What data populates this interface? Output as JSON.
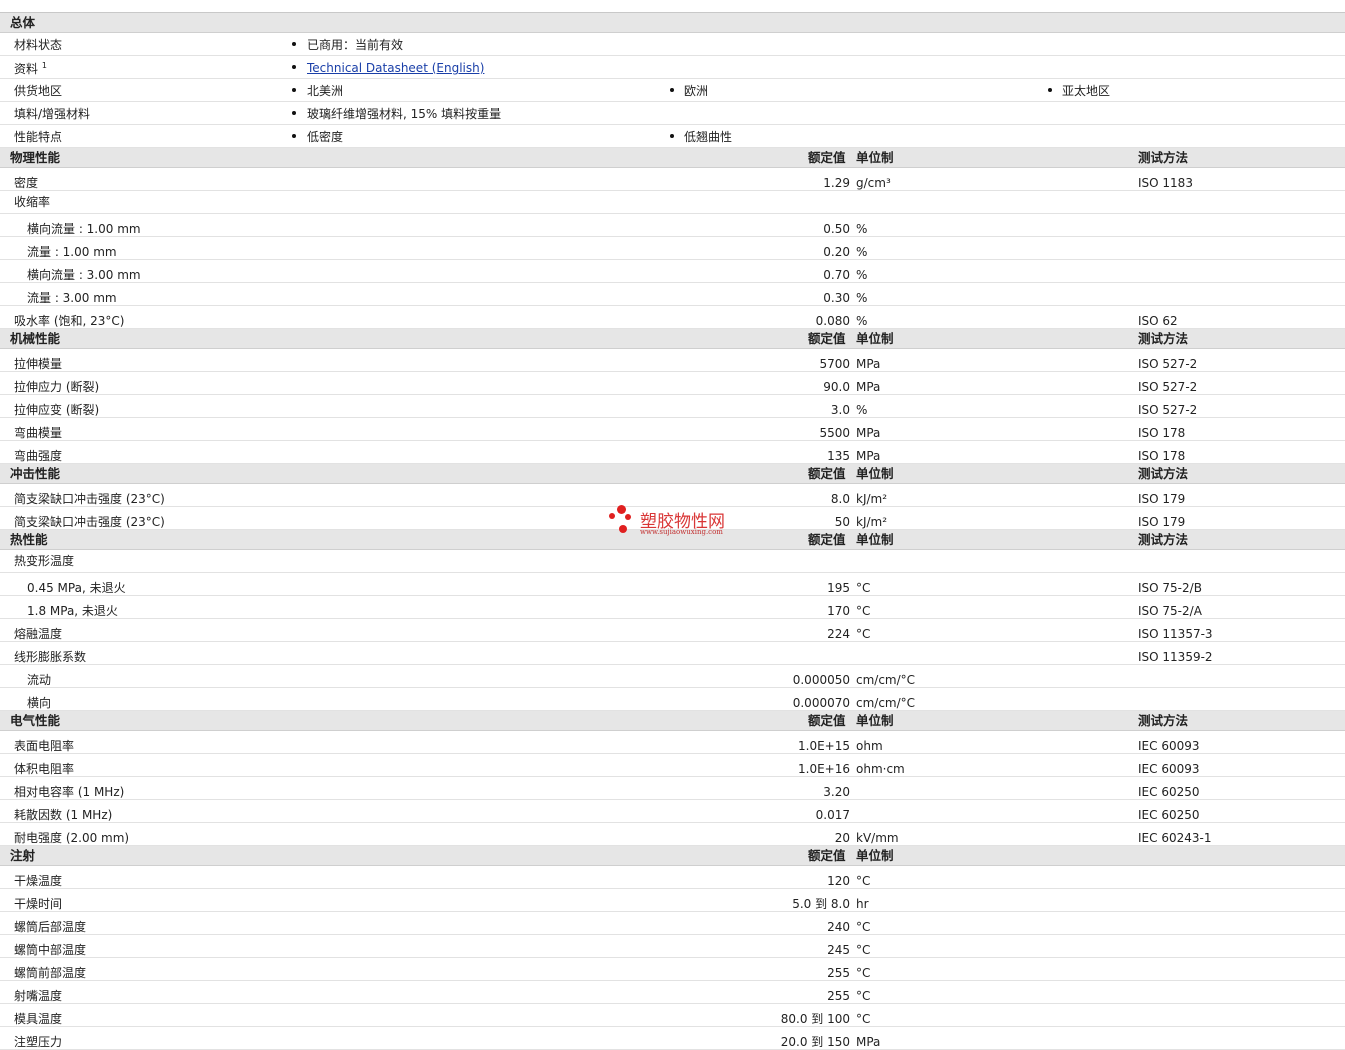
{
  "watermark": {
    "text": "塑胶物性网",
    "url": "www.sujiaowuxing.com"
  },
  "general": {
    "title": "总体",
    "status_label": "材料状态",
    "status_value": "已商用：当前有效",
    "docs_label": "资料",
    "docs_sup": "1",
    "docs_link": "Technical Datasheet (English)",
    "regions_label": "供货地区",
    "regions": [
      "北美洲",
      "欧洲",
      "亚太地区"
    ],
    "filler_label": "填料/增强材料",
    "filler_value": "玻璃纤维增强材料, 15% 填料按重量",
    "features_label": "性能特点",
    "features": [
      "低密度",
      "低翘曲性"
    ]
  },
  "headers": {
    "nominal": "额定值",
    "unit": "单位制",
    "method": "测试方法"
  },
  "sections": [
    {
      "title": "物理性能",
      "show_method": true,
      "rows": [
        {
          "label": "密度",
          "value": "1.29",
          "unit": "g/cm³",
          "method": "ISO 1183"
        },
        {
          "label": "收缩率",
          "value": "",
          "unit": "",
          "method": "",
          "group": true
        },
        {
          "label": "横向流量 : 1.00 mm",
          "value": "0.50",
          "unit": "%",
          "method": "",
          "sub": true
        },
        {
          "label": "流量 : 1.00 mm",
          "value": "0.20",
          "unit": "%",
          "method": "",
          "sub": true
        },
        {
          "label": "横向流量 : 3.00 mm",
          "value": "0.70",
          "unit": "%",
          "method": "",
          "sub": true
        },
        {
          "label": "流量 : 3.00 mm",
          "value": "0.30",
          "unit": "%",
          "method": "",
          "sub": true
        },
        {
          "label": "吸水率 (饱和, 23°C)",
          "value": "0.080",
          "unit": "%",
          "method": "ISO 62"
        }
      ]
    },
    {
      "title": "机械性能",
      "show_method": true,
      "rows": [
        {
          "label": "拉伸模量",
          "value": "5700",
          "unit": "MPa",
          "method": "ISO 527-2"
        },
        {
          "label": "拉伸应力 (断裂)",
          "value": "90.0",
          "unit": "MPa",
          "method": "ISO 527-2"
        },
        {
          "label": "拉伸应变 (断裂)",
          "value": "3.0",
          "unit": "%",
          "method": "ISO 527-2"
        },
        {
          "label": "弯曲模量",
          "value": "5500",
          "unit": "MPa",
          "method": "ISO 178"
        },
        {
          "label": "弯曲强度",
          "value": "135",
          "unit": "MPa",
          "method": "ISO 178"
        }
      ]
    },
    {
      "title": "冲击性能",
      "show_method": true,
      "rows": [
        {
          "label": "简支梁缺口冲击强度 (23°C)",
          "value": "8.0",
          "unit": "kJ/m²",
          "method": "ISO 179"
        },
        {
          "label": "简支梁缺口冲击强度 (23°C)",
          "value": "50",
          "unit": "kJ/m²",
          "method": "ISO 179"
        }
      ]
    },
    {
      "title": "热性能",
      "show_method": true,
      "rows": [
        {
          "label": "热变形温度",
          "value": "",
          "unit": "",
          "method": "",
          "group": true
        },
        {
          "label": "0.45 MPa, 未退火",
          "value": "195",
          "unit": "°C",
          "method": "ISO 75-2/B",
          "sub": true
        },
        {
          "label": "1.8 MPa, 未退火",
          "value": "170",
          "unit": "°C",
          "method": "ISO 75-2/A",
          "sub": true
        },
        {
          "label": "熔融温度",
          "value": "224",
          "unit": "°C",
          "method": "ISO 11357-3"
        },
        {
          "label": "线形膨胀系数",
          "value": "",
          "unit": "",
          "method": "ISO 11359-2"
        },
        {
          "label": "流动",
          "value": "0.000050",
          "unit": "cm/cm/°C",
          "method": "",
          "sub": true
        },
        {
          "label": "横向",
          "value": "0.000070",
          "unit": "cm/cm/°C",
          "method": "",
          "sub": true
        }
      ]
    },
    {
      "title": "电气性能",
      "show_method": true,
      "rows": [
        {
          "label": "表面电阻率",
          "value": "1.0E+15",
          "unit": "ohm",
          "method": "IEC 60093"
        },
        {
          "label": "体积电阻率",
          "value": "1.0E+16",
          "unit": "ohm·cm",
          "method": "IEC 60093"
        },
        {
          "label": "相对电容率 (1 MHz)",
          "value": "3.20",
          "unit": "",
          "method": "IEC 60250"
        },
        {
          "label": "耗散因数 (1 MHz)",
          "value": "0.017",
          "unit": "",
          "method": "IEC 60250"
        },
        {
          "label": "耐电强度 (2.00 mm)",
          "value": "20",
          "unit": "kV/mm",
          "method": "IEC 60243-1"
        }
      ]
    },
    {
      "title": "注射",
      "show_method": false,
      "rows": [
        {
          "label": "干燥温度",
          "value": "120",
          "unit": "°C",
          "method": ""
        },
        {
          "label": "干燥时间",
          "value": "5.0 到 8.0",
          "unit": "hr",
          "method": ""
        },
        {
          "label": "螺筒后部温度",
          "value": "240",
          "unit": "°C",
          "method": ""
        },
        {
          "label": "螺筒中部温度",
          "value": "245",
          "unit": "°C",
          "method": ""
        },
        {
          "label": "螺筒前部温度",
          "value": "255",
          "unit": "°C",
          "method": ""
        },
        {
          "label": "射嘴温度",
          "value": "255",
          "unit": "°C",
          "method": ""
        },
        {
          "label": "模具温度",
          "value": "80.0 到 100",
          "unit": "°C",
          "method": ""
        },
        {
          "label": "注塑压力",
          "value": "20.0 到 150",
          "unit": "MPa",
          "method": ""
        }
      ]
    }
  ]
}
